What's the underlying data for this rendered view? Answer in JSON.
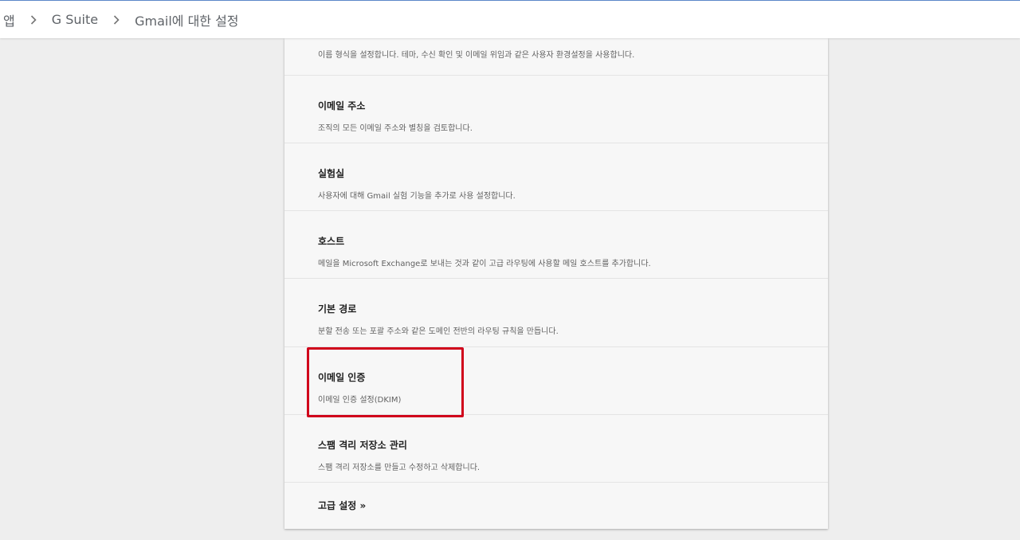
{
  "breadcrumb": {
    "items": [
      "앱",
      "G Suite",
      "Gmail에 대한 설정"
    ]
  },
  "settings": {
    "first_desc": "이름 형식을 설정합니다. 테마, 수신 확인 및 이메일 위임과 같은 사용자 환경설정을 사용합니다.",
    "rows": [
      {
        "title": "이메일 주소",
        "desc": "조직의 모든 이메일 주소와 별칭을 검토합니다."
      },
      {
        "title": "실험실",
        "desc": "사용자에 대해 Gmail 실험 기능을 추가로 사용 설정합니다."
      },
      {
        "title": "호스트",
        "desc": "메일을 Microsoft Exchange로 보내는 것과 같이 고급 라우팅에 사용할 메일 호스트를 추가합니다."
      },
      {
        "title": "기본 경로",
        "desc": "분할 전송 또는 포괄 주소와 같은 도메인 전반의 라우팅 규칙을 만듭니다."
      },
      {
        "title": "이메일 인증",
        "desc": "이메일 인증 설정(DKIM)"
      },
      {
        "title": "스팸 격리 저장소 관리",
        "desc": "스팸 격리 저장소를 만들고 수정하고 삭제합니다."
      }
    ],
    "advanced_label": "고급 설정 »"
  },
  "colors": {
    "highlight": "#d0021b",
    "topbar_border": "#5b87c8"
  }
}
